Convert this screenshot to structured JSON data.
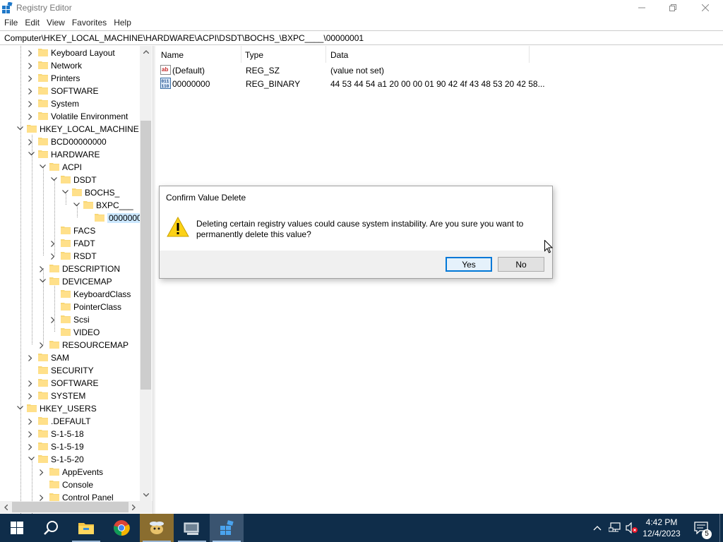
{
  "window": {
    "title": "Registry Editor",
    "minimize_icon": "minimize-icon",
    "maximize_icon": "restore-icon",
    "close_icon": "close-icon"
  },
  "menu": [
    "File",
    "Edit",
    "View",
    "Favorites",
    "Help"
  ],
  "address": "Computer\\HKEY_LOCAL_MACHINE\\HARDWARE\\ACPI\\DSDT\\BOCHS_\\BXPC____\\00000001",
  "tree": [
    {
      "label": "Keyboard Layout",
      "toggle": "collapsed",
      "id": "keyboard-layout"
    },
    {
      "label": "Network",
      "toggle": "collapsed",
      "id": "network"
    },
    {
      "label": "Printers",
      "toggle": "collapsed",
      "id": "printers"
    },
    {
      "label": "SOFTWARE",
      "toggle": "collapsed",
      "id": "software-hkcu"
    },
    {
      "label": "System",
      "toggle": "collapsed",
      "id": "system-hkcu"
    },
    {
      "label": "Volatile Environment",
      "toggle": "collapsed",
      "id": "volatile-environment"
    },
    {
      "label": "HKEY_LOCAL_MACHINE",
      "toggle": "expanded",
      "id": "hklm"
    },
    {
      "label": "BCD00000000",
      "toggle": "collapsed",
      "id": "bcd"
    },
    {
      "label": "HARDWARE",
      "toggle": "expanded",
      "id": "hardware"
    },
    {
      "label": "ACPI",
      "toggle": "expanded",
      "id": "acpi"
    },
    {
      "label": "DSDT",
      "toggle": "expanded",
      "id": "dsdt"
    },
    {
      "label": "BOCHS_",
      "toggle": "expanded",
      "id": "bochs"
    },
    {
      "label": "BXPC___",
      "toggle": "expanded",
      "id": "bxpc"
    },
    {
      "label": "0000000",
      "toggle": "none",
      "id": "00000001"
    },
    {
      "label": "FACS",
      "toggle": "none",
      "id": "facs"
    },
    {
      "label": "FADT",
      "toggle": "collapsed",
      "id": "fadt"
    },
    {
      "label": "RSDT",
      "toggle": "collapsed",
      "id": "rsdt"
    },
    {
      "label": "DESCRIPTION",
      "toggle": "collapsed",
      "id": "description"
    },
    {
      "label": "DEVICEMAP",
      "toggle": "expanded",
      "id": "devicemap"
    },
    {
      "label": "KeyboardClass",
      "toggle": "none",
      "id": "keyboardclass"
    },
    {
      "label": "PointerClass",
      "toggle": "none",
      "id": "pointerclass"
    },
    {
      "label": "Scsi",
      "toggle": "collapsed",
      "id": "scsi"
    },
    {
      "label": "VIDEO",
      "toggle": "none",
      "id": "video"
    },
    {
      "label": "RESOURCEMAP",
      "toggle": "collapsed",
      "id": "resourcemap"
    },
    {
      "label": "SAM",
      "toggle": "collapsed",
      "id": "sam"
    },
    {
      "label": "SECURITY",
      "toggle": "none",
      "id": "security"
    },
    {
      "label": "SOFTWARE",
      "toggle": "collapsed",
      "id": "software-hklm"
    },
    {
      "label": "SYSTEM",
      "toggle": "collapsed",
      "id": "system-hklm"
    },
    {
      "label": "HKEY_USERS",
      "toggle": "expanded",
      "id": "hku"
    },
    {
      "label": ".DEFAULT",
      "toggle": "collapsed",
      "id": "default"
    },
    {
      "label": "S-1-5-18",
      "toggle": "collapsed",
      "id": "s-1-5-18"
    },
    {
      "label": "S-1-5-19",
      "toggle": "collapsed",
      "id": "s-1-5-19"
    },
    {
      "label": "S-1-5-20",
      "toggle": "expanded",
      "id": "s-1-5-20"
    },
    {
      "label": "AppEvents",
      "toggle": "collapsed",
      "id": "appevents"
    },
    {
      "label": "Console",
      "toggle": "none",
      "id": "console"
    },
    {
      "label": "Control Panel",
      "toggle": "collapsed",
      "id": "control-panel"
    }
  ],
  "list": {
    "columns": [
      "Name",
      "Type",
      "Data"
    ],
    "rows": [
      {
        "icon": "string-value-icon",
        "name": "(Default)",
        "type": "REG_SZ",
        "data": "(value not set)"
      },
      {
        "icon": "binary-value-icon",
        "name": "00000000",
        "type": "REG_BINARY",
        "data": "44 53 44 54 a1 20 00 00 01 90 42 4f 43 48 53 20 42 58..."
      }
    ]
  },
  "dialog": {
    "title": "Confirm Value Delete",
    "message": "Deleting certain registry values could cause system instability. Are you sure you want to permanently delete this value?",
    "icon": "warning-icon",
    "yes_label": "Yes",
    "no_label": "No"
  },
  "taskbar": {
    "apps": [
      "start-icon",
      "search-icon",
      "file-explorer-icon",
      "chrome-icon",
      "app-icon",
      "network-app-icon",
      "registry-editor-icon"
    ],
    "time": "4:42 PM",
    "date": "12/4/2023",
    "notification_count": "5"
  }
}
